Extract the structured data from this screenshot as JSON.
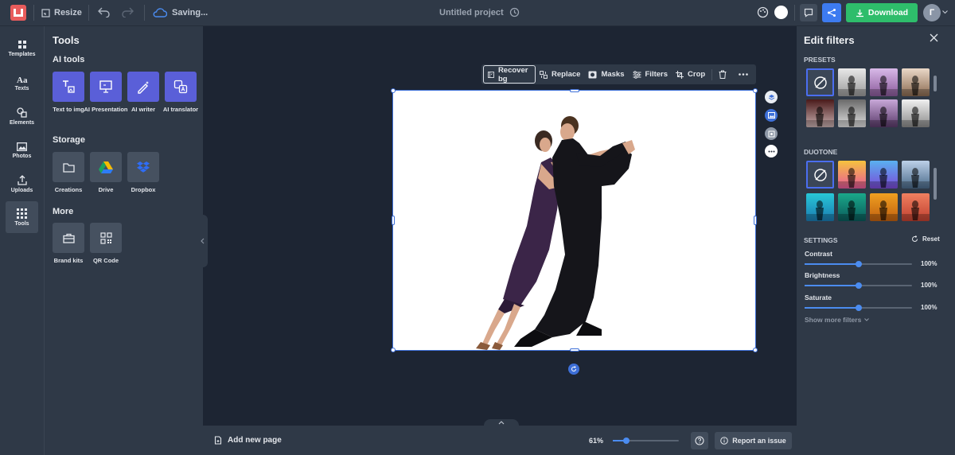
{
  "topbar": {
    "resize_label": "Resize",
    "status": "Saving...",
    "project_title": "Untitled project",
    "download_label": "Download",
    "avatar_initial": "Г"
  },
  "rail": {
    "items": [
      {
        "label": "Templates"
      },
      {
        "label": "Texts"
      },
      {
        "label": "Elements"
      },
      {
        "label": "Photos"
      },
      {
        "label": "Uploads"
      },
      {
        "label": "Tools"
      }
    ]
  },
  "tools_panel": {
    "title": "Tools",
    "ai_title": "AI tools",
    "ai_tools": [
      {
        "label": "Text to img"
      },
      {
        "label": "AI Presentation"
      },
      {
        "label": "AI writer"
      },
      {
        "label": "AI translator"
      }
    ],
    "storage_title": "Storage",
    "storage": [
      {
        "label": "Creations"
      },
      {
        "label": "Drive"
      },
      {
        "label": "Dropbox"
      }
    ],
    "more_title": "More",
    "more": [
      {
        "label": "Brand kits"
      },
      {
        "label": "QR Code"
      }
    ]
  },
  "context_toolbar": {
    "recover_bg": "Recover bg",
    "replace": "Replace",
    "masks": "Masks",
    "filters": "Filters",
    "crop": "Crop"
  },
  "bottombar": {
    "add_page": "Add new page",
    "zoom": "61%",
    "zoom_fraction": 0.2,
    "report": "Report an issue"
  },
  "filters_panel": {
    "title": "Edit filters",
    "presets_title": "PRESETS",
    "duotone_title": "DUOTONE",
    "settings_title": "SETTINGS",
    "reset_label": "Reset",
    "settings": [
      {
        "label": "Contrast",
        "value": "100%",
        "fraction": 0.5
      },
      {
        "label": "Brightness",
        "value": "100%",
        "fraction": 0.5
      },
      {
        "label": "Saturate",
        "value": "100%",
        "fraction": 0.5
      }
    ],
    "show_more": "Show more filters"
  },
  "colors": {
    "accent": "#4b6ef0",
    "download_green": "#2ebd6b",
    "ai_purple": "#5a5fd8",
    "panel_bg": "#2f3947",
    "canvas_bg": "#1d2533"
  }
}
